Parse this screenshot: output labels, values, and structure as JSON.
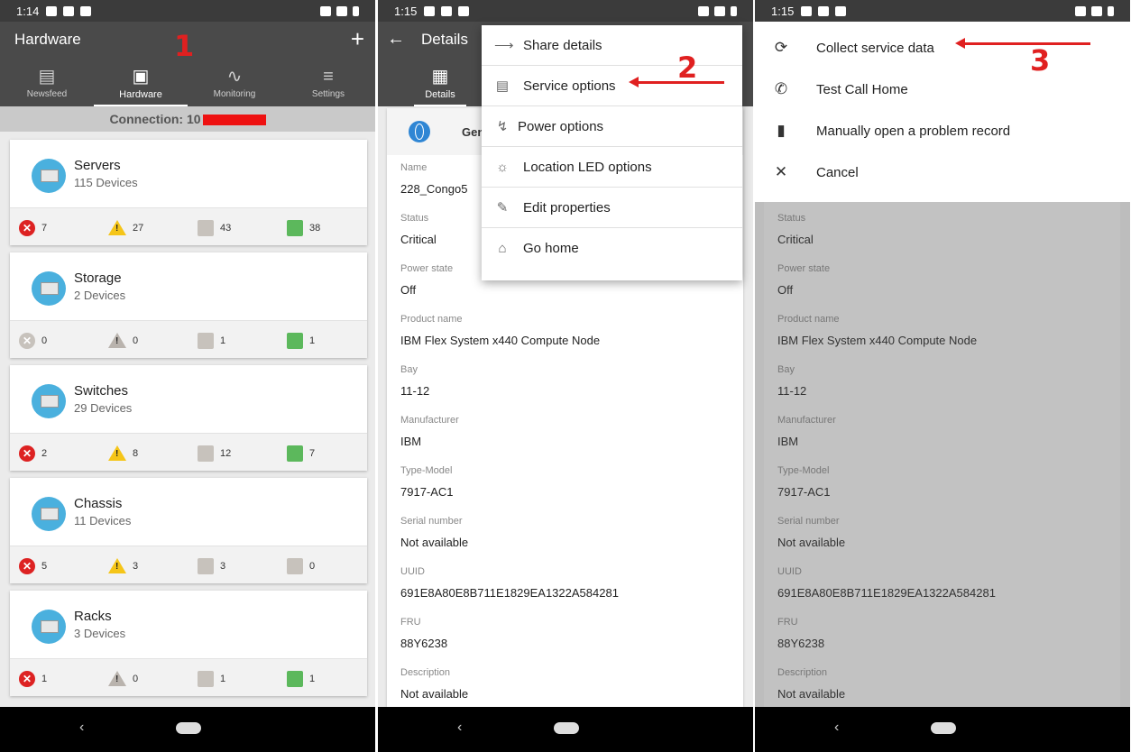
{
  "panel1": {
    "status": {
      "time": "1:14"
    },
    "title": "Hardware",
    "add_icon": "plus-icon",
    "tabs": [
      {
        "label": "Newsfeed",
        "icon": "newsfeed-icon"
      },
      {
        "label": "Hardware",
        "icon": "monitor-icon",
        "active": true
      },
      {
        "label": "Monitoring",
        "icon": "pulse-icon"
      },
      {
        "label": "Settings",
        "icon": "sliders-icon"
      }
    ],
    "connection_label": "Connection: 10",
    "annotation": "1",
    "categories": [
      {
        "name": "Servers",
        "devices": "115 Devices",
        "critical": "7",
        "warning": "27",
        "unknown": "43",
        "normal": "38"
      },
      {
        "name": "Storage",
        "devices": "2 Devices",
        "critical": "0",
        "warning": "0",
        "unknown": "1",
        "normal": "1"
      },
      {
        "name": "Switches",
        "devices": "29 Devices",
        "critical": "2",
        "warning": "8",
        "unknown": "12",
        "normal": "7"
      },
      {
        "name": "Chassis",
        "devices": "11 Devices",
        "critical": "5",
        "warning": "3",
        "unknown": "3",
        "normal": "0"
      },
      {
        "name": "Racks",
        "devices": "3 Devices",
        "critical": "1",
        "warning": "0",
        "unknown": "1",
        "normal": "1"
      }
    ]
  },
  "panel2": {
    "status": {
      "time": "1:15"
    },
    "title": "Details",
    "tab_label": "Details",
    "general_label": "Gen",
    "annotation": "2",
    "menu": [
      {
        "label": "Share details",
        "icon": "share-icon"
      },
      {
        "label": "Service options",
        "icon": "service-icon"
      },
      {
        "label": "Power options",
        "icon": "power-icon"
      },
      {
        "label": "Location LED options",
        "icon": "led-icon"
      },
      {
        "label": "Edit properties",
        "icon": "pencil-icon"
      },
      {
        "label": "Go home",
        "icon": "home-icon"
      }
    ],
    "fields": [
      {
        "label": "Name",
        "value": "228_Congo5"
      },
      {
        "label": "Status",
        "value": "Critical"
      },
      {
        "label": "Power state",
        "value": "Off"
      },
      {
        "label": "Product name",
        "value": "IBM Flex System x440 Compute Node"
      },
      {
        "label": "Bay",
        "value": "11-12"
      },
      {
        "label": "Manufacturer",
        "value": "IBM"
      },
      {
        "label": "Type-Model",
        "value": "7917-AC1"
      },
      {
        "label": "Serial number",
        "value": "Not available"
      },
      {
        "label": "UUID",
        "value": "691E8A80E8B711E1829EA1322A584281"
      },
      {
        "label": "FRU",
        "value": "88Y6238"
      },
      {
        "label": "Description",
        "value": "Not available"
      }
    ]
  },
  "panel3": {
    "status": {
      "time": "1:15"
    },
    "annotation": "3",
    "sheet": [
      {
        "label": "Collect service data",
        "icon": "refresh-icon"
      },
      {
        "label": "Test Call Home",
        "icon": "phone-icon"
      },
      {
        "label": "Manually open a problem record",
        "icon": "document-icon"
      },
      {
        "label": "Cancel",
        "icon": "close-icon"
      }
    ],
    "fields": [
      {
        "label": "Status",
        "value": "Critical"
      },
      {
        "label": "Power state",
        "value": "Off"
      },
      {
        "label": "Product name",
        "value": "IBM Flex System x440 Compute Node"
      },
      {
        "label": "Bay",
        "value": "11-12"
      },
      {
        "label": "Manufacturer",
        "value": "IBM"
      },
      {
        "label": "Type-Model",
        "value": "7917-AC1"
      },
      {
        "label": "Serial number",
        "value": "Not available"
      },
      {
        "label": "UUID",
        "value": "691E8A80E8B711E1829EA1322A584281"
      },
      {
        "label": "FRU",
        "value": "88Y6238"
      },
      {
        "label": "Description",
        "value": "Not available"
      }
    ]
  },
  "colors": {
    "critical": "#dd2222",
    "warning": "#f5c518",
    "normal": "#5cb85c",
    "unknown": "#c7c2bc",
    "annotation": "#e02020",
    "appbar": "#4a4a4a"
  }
}
